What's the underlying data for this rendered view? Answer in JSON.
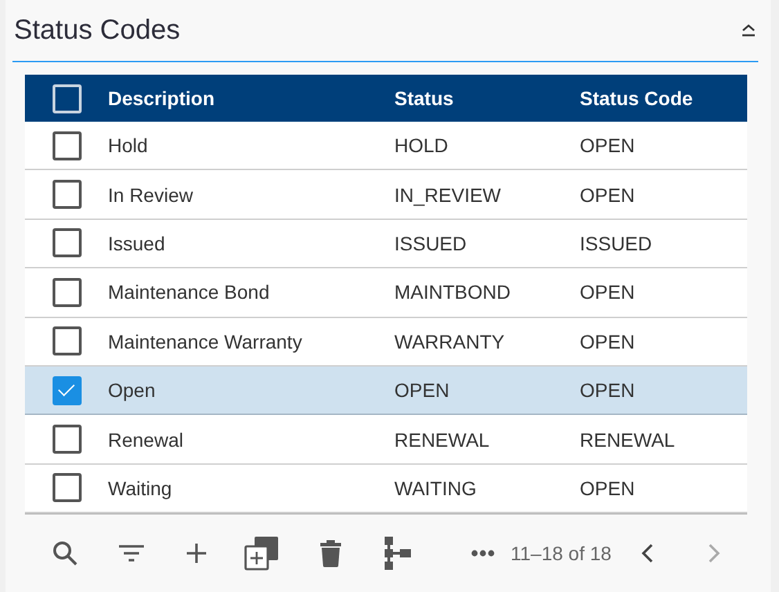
{
  "panel": {
    "title": "Status Codes",
    "expanded": true
  },
  "table": {
    "all_selected": false,
    "columns": [
      "Description",
      "Status",
      "Status Code"
    ],
    "rows": [
      {
        "cells": [
          "Hold",
          "HOLD",
          "OPEN"
        ],
        "selected": false
      },
      {
        "cells": [
          "In Review",
          "IN_REVIEW",
          "OPEN"
        ],
        "selected": false
      },
      {
        "cells": [
          "Issued",
          "ISSUED",
          "ISSUED"
        ],
        "selected": false
      },
      {
        "cells": [
          "Maintenance Bond",
          "MAINTBOND",
          "OPEN"
        ],
        "selected": false
      },
      {
        "cells": [
          "Maintenance Warranty",
          "WARRANTY",
          "OPEN"
        ],
        "selected": false
      },
      {
        "cells": [
          "Open",
          "OPEN",
          "OPEN"
        ],
        "selected": true
      },
      {
        "cells": [
          "Renewal",
          "RENEWAL",
          "RENEWAL"
        ],
        "selected": false
      },
      {
        "cells": [
          "Waiting",
          "WAITING",
          "OPEN"
        ],
        "selected": false
      }
    ]
  },
  "toolbar": {
    "tools": [
      {
        "kind": "search"
      },
      {
        "kind": "filter"
      },
      {
        "kind": "add"
      },
      {
        "kind": "copy"
      },
      {
        "kind": "delete"
      },
      {
        "kind": "hierarchy"
      },
      {
        "kind": "more"
      }
    ],
    "pager": {
      "range": "11–18 of 18",
      "prev_disabled": false,
      "next_disabled": true
    }
  }
}
